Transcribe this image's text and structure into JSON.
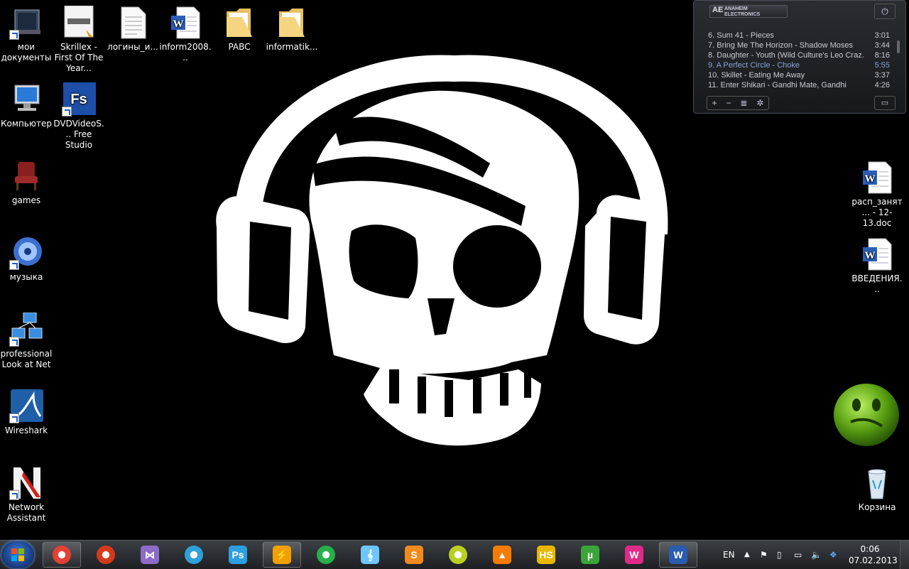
{
  "desktop_icons_left": [
    {
      "label": "мои документы",
      "icon": "my-documents-icon"
    },
    {
      "label": "Skrillex - First Of The Year...",
      "icon": "image-file-icon"
    },
    {
      "label": "логины_и...",
      "icon": "text-file-icon"
    },
    {
      "label": "inform2008...",
      "icon": "word-doc-icon"
    },
    {
      "label": "PABC",
      "icon": "folder-icon"
    },
    {
      "label": "informatik...",
      "icon": "folder-icon"
    },
    {
      "label": "Компьютер",
      "icon": "computer-icon"
    },
    {
      "label": "DVDVideoS... Free Studio",
      "icon": "fs-icon"
    },
    {
      "label": "games",
      "icon": "chair-icon"
    },
    {
      "label": "музыка",
      "icon": "music-icon"
    },
    {
      "label": "professional Look at Net",
      "icon": "network-icon"
    },
    {
      "label": "Wireshark",
      "icon": "wireshark-icon"
    },
    {
      "label": "Network Assistant",
      "icon": "network-assistant-icon"
    }
  ],
  "desktop_icons_right": [
    {
      "label": "расп_занят... - 12-13.doc",
      "icon": "word-doc-icon"
    },
    {
      "label": "ВВЕДЕНИЯ...",
      "icon": "word-doc-icon"
    },
    {
      "label": "Корзина",
      "icon": "recycle-bin-icon"
    }
  ],
  "player": {
    "brand_logo": "AE",
    "brand_line1": "ANAHEIM",
    "brand_line2": "ELECTRONICS",
    "tracks": [
      {
        "title": "6. Sum 41 - Pieces",
        "duration": "3:01",
        "active": false
      },
      {
        "title": "7. Bring Me The Horizon - Shadow Moses",
        "duration": "3:44",
        "active": false
      },
      {
        "title": "8. Daughter - Youth (Wild Culture's Leo Craz...",
        "duration": "8:16",
        "active": false
      },
      {
        "title": "9. A Perfect Circle - Choke",
        "duration": "5:55",
        "active": true
      },
      {
        "title": "10. Skillet - Eating Me Away",
        "duration": "3:37",
        "active": false
      },
      {
        "title": "11. Enter Shikari - Gandhi Mate, Gandhi",
        "duration": "4:26",
        "active": false
      }
    ],
    "controls": [
      "+",
      "−",
      "≣",
      "✲"
    ]
  },
  "taskbar": {
    "apps": [
      {
        "name": "chrome-icon",
        "glyph": "",
        "color": "#e34133"
      },
      {
        "name": "burner-icon",
        "glyph": "",
        "color": "#d43a1a"
      },
      {
        "name": "visual-studio-icon",
        "glyph": "⋈",
        "color": "#8c6cc8"
      },
      {
        "name": "navigator-icon",
        "glyph": "",
        "color": "#2fa0d8"
      },
      {
        "name": "photoshop-icon",
        "glyph": "Ps",
        "color": "#2b9fe0"
      },
      {
        "name": "winamp-icon",
        "glyph": "⚡",
        "color": "#f0a000"
      },
      {
        "name": "sonic-icon",
        "glyph": "",
        "color": "#26b04a"
      },
      {
        "name": "music-editor-icon",
        "glyph": "𝄞",
        "color": "#6ec6ff"
      },
      {
        "name": "sublime-icon",
        "glyph": "S",
        "color": "#f28a1e"
      },
      {
        "name": "robot-icon",
        "glyph": "",
        "color": "#b9d020"
      },
      {
        "name": "vlc-icon",
        "glyph": "▲",
        "color": "#f57c00"
      },
      {
        "name": "hs-icon",
        "glyph": "HS",
        "color": "#e8b800"
      },
      {
        "name": "utorrent-icon",
        "glyph": "µ",
        "color": "#3aa63a"
      },
      {
        "name": "web-icon",
        "glyph": "W",
        "color": "#e02a8a"
      },
      {
        "name": "word-icon",
        "glyph": "W",
        "color": "#2a5cb0"
      }
    ],
    "language": "EN",
    "time": "0:06",
    "date": "07.02.2013"
  }
}
